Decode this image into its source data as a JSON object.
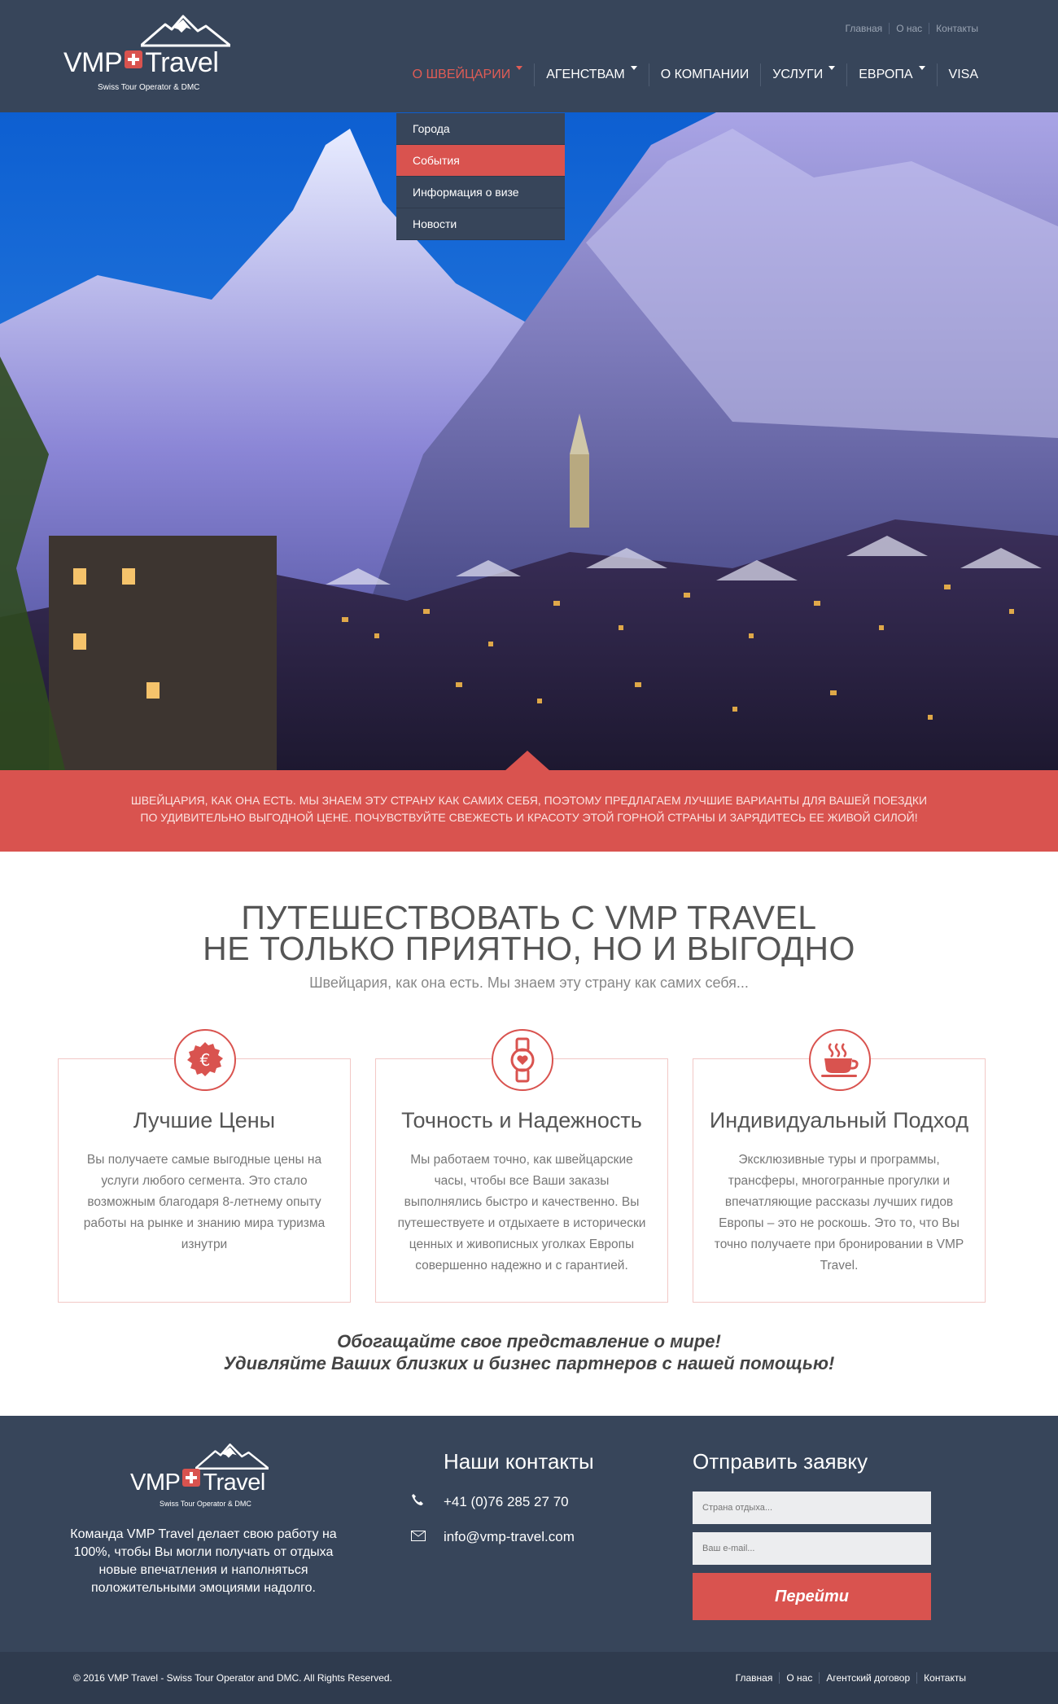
{
  "brand": {
    "name_left": "VMP",
    "name_right": "Travel",
    "tagline": "Swiss Tour Operator & DMC"
  },
  "topnav": [
    "Главная",
    "О нас",
    "Контакты"
  ],
  "mainnav": [
    {
      "label": "О ШВЕЙЦАРИИ",
      "dropdown": true,
      "active": true
    },
    {
      "label": "АГЕНСТВАМ",
      "dropdown": true
    },
    {
      "label": "О КОМПАНИИ",
      "dropdown": false
    },
    {
      "label": "УСЛУГИ",
      "dropdown": true
    },
    {
      "label": "ЕВРОПА",
      "dropdown": true
    },
    {
      "label": "VISA",
      "dropdown": false
    }
  ],
  "dropdown": [
    {
      "label": "Города"
    },
    {
      "label": "События",
      "selected": true
    },
    {
      "label": "Информация о визе"
    },
    {
      "label": "Новости"
    }
  ],
  "banner": {
    "line1": "Швейцария, как она есть. Мы знаем эту страну как самих себя, поэтому предлагаем лучшие варианты для вашей поездки",
    "line2": "по удивительно выгодной цене. Почувствуйте свежесть и красоту этой горной страны и зарядитесь ее живой силой!"
  },
  "intro": {
    "title_line1": "ПУТЕШЕСТВОВАТЬ С VMP TRAVEL",
    "title_line2": "НЕ ТОЛЬКО ПРИЯТНО, НО И ВЫГОДНО",
    "subtitle": "Швейцария, как она есть. Мы знаем эту страну как самих себя..."
  },
  "features": [
    {
      "icon": "euro-icon",
      "title": "Лучшие Цены",
      "text": "Вы получаете самые выгодные цены на услуги любого сегмента. Это стало возможным благодаря 8-летнему опыту работы на рынке и знанию мира туризма изнутри"
    },
    {
      "icon": "watch-icon",
      "title": "Точность и Надежность",
      "text": "Мы работаем точно, как швейцарские часы, чтобы все Ваши заказы выполнялись быстро и качественно. Вы путешествуете и отдыхаете в исторически ценных и живописных уголках Европы совершенно надежно и с гарантией."
    },
    {
      "icon": "coffee-cup-icon",
      "title": "Индивидуальный Подход",
      "text": "Эксклюзивные туры и программы, трансферы, многогранные прогулки и впечатляющие рассказы лучших гидов Европы – это не роскошь. Это то, что Вы точно получаете при бронировании в VMP Travel."
    }
  ],
  "motto": {
    "line1": "Обогащайте свое представление о мире!",
    "line2": "Удивляйте Ваших близких и бизнес партнеров с нашей помощью!"
  },
  "footer": {
    "description": "Команда VMP Travel делает свою работу на 100%, чтобы Вы могли получать от отдыха новые впечатления и наполняться положительными эмоциями надолго.",
    "contacts_title": "Наши контакты",
    "phone": "+41 (0)76 285 27 70",
    "email": "info@vmp-travel.com",
    "form_title": "Отправить заявку",
    "country_placeholder": "Страна отдыха...",
    "email_placeholder": "Ваш e-mail...",
    "submit_label": "Перейти"
  },
  "bottombar": {
    "copyright": "© 2016 VMP Travel - Swiss Tour Operator and DMC. All Rights Reserved.",
    "links": [
      "Главная",
      "О нас",
      "Агентский договор",
      "Контакты"
    ]
  },
  "colors": {
    "header_bg": "#37455a",
    "accent": "#d9534f",
    "bottombar_bg": "#2f3b4e"
  }
}
